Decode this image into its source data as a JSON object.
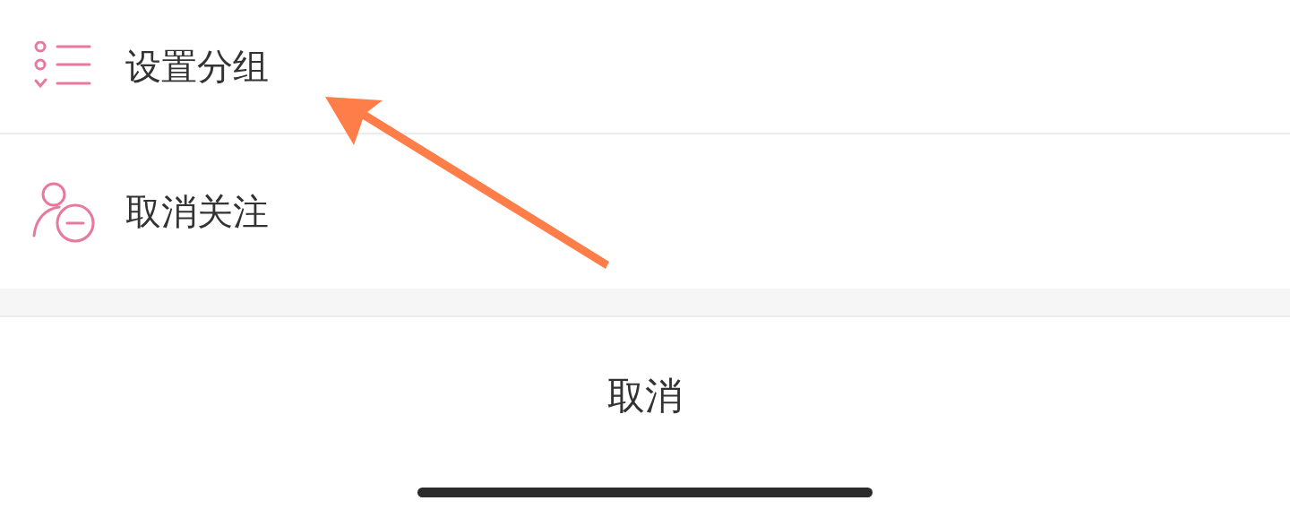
{
  "menu_items": [
    {
      "kind": "group",
      "label": "设置分组"
    },
    {
      "kind": "unfollow",
      "label": "取消关注"
    }
  ],
  "cancel_button": "取消"
}
